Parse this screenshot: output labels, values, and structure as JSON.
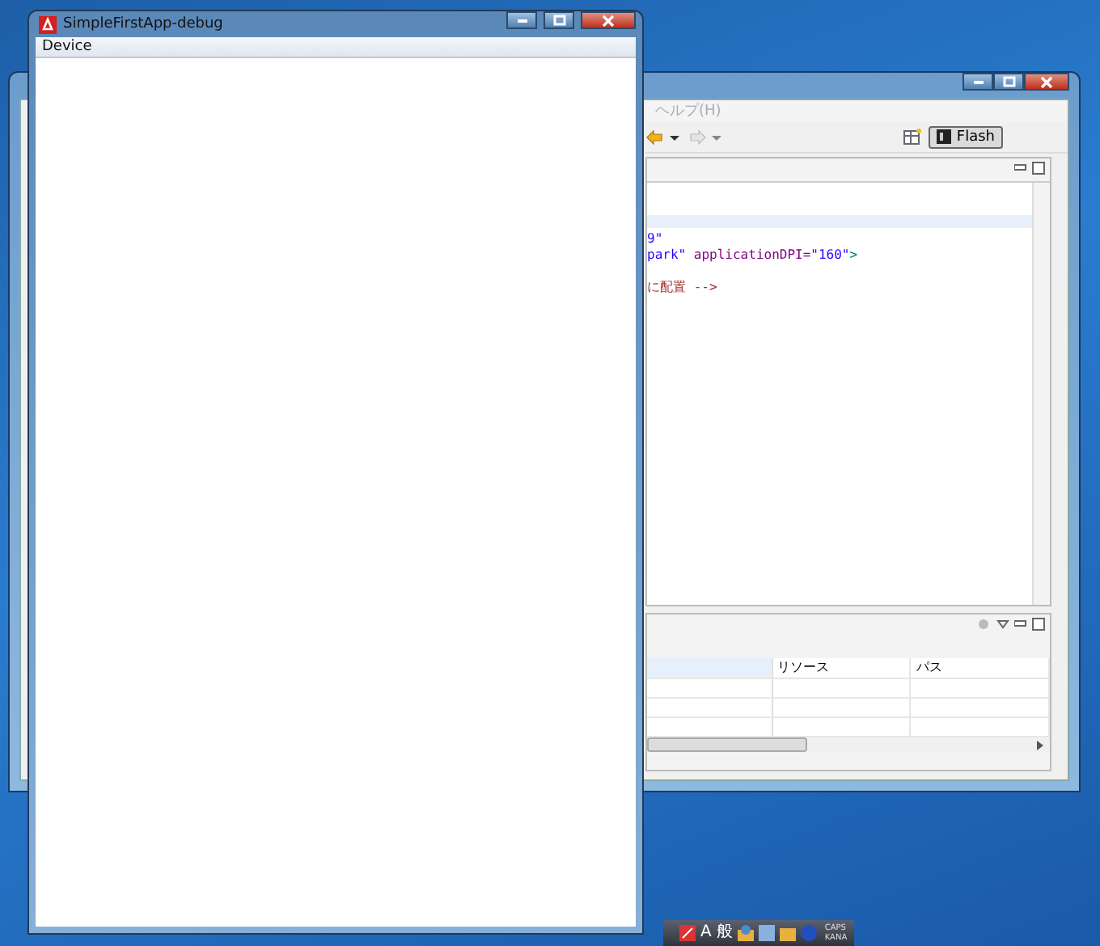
{
  "back_window": {
    "menu": [
      "ヘルプ(H)"
    ],
    "perspective": {
      "label": "Flash",
      "selected": true
    },
    "editor_lines": [
      {
        "segments": [
          {
            "text": "9\"",
            "kind": "string"
          }
        ]
      },
      {
        "segments": [
          {
            "text": "park\"",
            "kind": "string"
          },
          {
            "text": " applicationDPI=",
            "kind": "attr"
          },
          {
            "text": "\"160\"",
            "kind": "string"
          },
          {
            "text": ">",
            "kind": "tag"
          }
        ]
      },
      {
        "segments": [
          {
            "text": "に配置 -->",
            "kind": "comment"
          }
        ]
      }
    ],
    "table": {
      "columns": [
        "リソース",
        "パス"
      ]
    }
  },
  "front_window": {
    "title": "SimpleFirstApp-debug",
    "menu": [
      "Device"
    ]
  },
  "language_bar": {
    "mode": "A",
    "ime": "般",
    "indicators": [
      "CAPS",
      "KANA"
    ]
  }
}
